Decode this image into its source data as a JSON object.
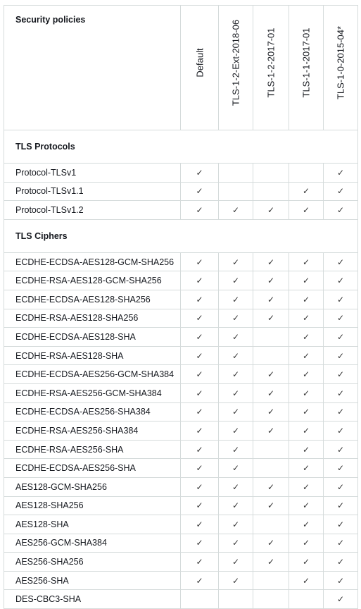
{
  "header": {
    "corner": "Security policies",
    "columns": [
      "Default",
      "TLS-1-2-Ext-2018-06",
      "TLS-1-2-2017-01",
      "TLS-1-1-2017-01",
      "TLS-1-0-2015-04*"
    ]
  },
  "check_mark": "✓",
  "sections": [
    {
      "title": "TLS Protocols",
      "rows": [
        {
          "name": "Protocol-TLSv1",
          "checks": [
            true,
            false,
            false,
            false,
            true
          ]
        },
        {
          "name": "Protocol-TLSv1.1",
          "checks": [
            true,
            false,
            false,
            true,
            true
          ]
        },
        {
          "name": "Protocol-TLSv1.2",
          "checks": [
            true,
            true,
            true,
            true,
            true
          ]
        }
      ]
    },
    {
      "title": "TLS Ciphers",
      "rows": [
        {
          "name": "ECDHE-ECDSA-AES128-GCM-SHA256",
          "checks": [
            true,
            true,
            true,
            true,
            true
          ]
        },
        {
          "name": "ECDHE-RSA-AES128-GCM-SHA256",
          "checks": [
            true,
            true,
            true,
            true,
            true
          ]
        },
        {
          "name": "ECDHE-ECDSA-AES128-SHA256",
          "checks": [
            true,
            true,
            true,
            true,
            true
          ]
        },
        {
          "name": "ECDHE-RSA-AES128-SHA256",
          "checks": [
            true,
            true,
            true,
            true,
            true
          ]
        },
        {
          "name": "ECDHE-ECDSA-AES128-SHA",
          "checks": [
            true,
            true,
            false,
            true,
            true
          ]
        },
        {
          "name": "ECDHE-RSA-AES128-SHA",
          "checks": [
            true,
            true,
            false,
            true,
            true
          ]
        },
        {
          "name": "ECDHE-ECDSA-AES256-GCM-SHA384",
          "checks": [
            true,
            true,
            true,
            true,
            true
          ]
        },
        {
          "name": "ECDHE-RSA-AES256-GCM-SHA384",
          "checks": [
            true,
            true,
            true,
            true,
            true
          ]
        },
        {
          "name": "ECDHE-ECDSA-AES256-SHA384",
          "checks": [
            true,
            true,
            true,
            true,
            true
          ]
        },
        {
          "name": "ECDHE-RSA-AES256-SHA384",
          "checks": [
            true,
            true,
            true,
            true,
            true
          ]
        },
        {
          "name": "ECDHE-RSA-AES256-SHA",
          "checks": [
            true,
            true,
            false,
            true,
            true
          ]
        },
        {
          "name": "ECDHE-ECDSA-AES256-SHA",
          "checks": [
            true,
            true,
            false,
            true,
            true
          ]
        },
        {
          "name": "AES128-GCM-SHA256",
          "checks": [
            true,
            true,
            true,
            true,
            true
          ]
        },
        {
          "name": "AES128-SHA256",
          "checks": [
            true,
            true,
            true,
            true,
            true
          ]
        },
        {
          "name": "AES128-SHA",
          "checks": [
            true,
            true,
            false,
            true,
            true
          ]
        },
        {
          "name": "AES256-GCM-SHA384",
          "checks": [
            true,
            true,
            true,
            true,
            true
          ]
        },
        {
          "name": "AES256-SHA256",
          "checks": [
            true,
            true,
            true,
            true,
            true
          ]
        },
        {
          "name": "AES256-SHA",
          "checks": [
            true,
            true,
            false,
            true,
            true
          ]
        },
        {
          "name": "DES-CBC3-SHA",
          "checks": [
            false,
            false,
            false,
            false,
            true
          ]
        }
      ]
    }
  ]
}
